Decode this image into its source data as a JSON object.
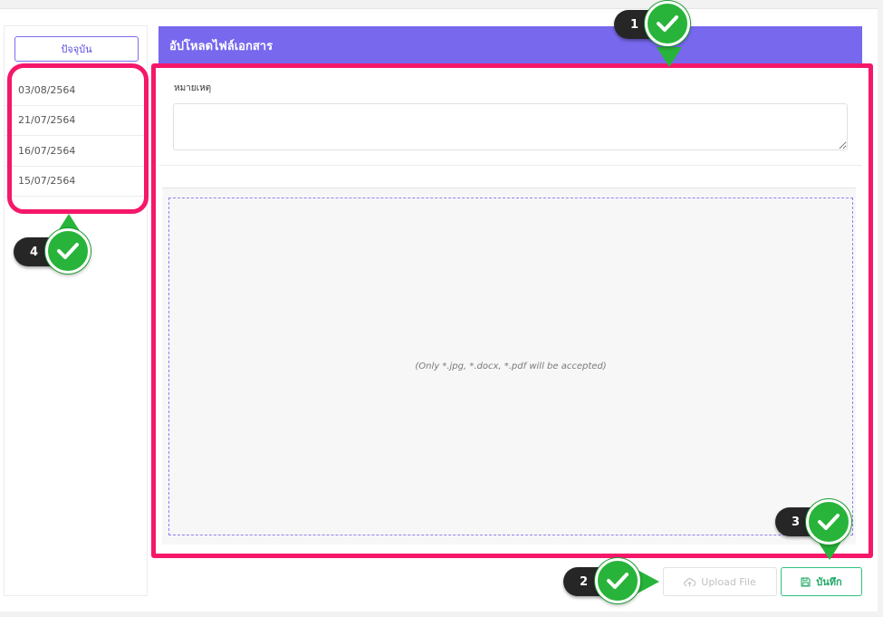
{
  "sidebar": {
    "current_label": "ปัจจุบัน",
    "dates": [
      "03/08/2564",
      "21/07/2564",
      "16/07/2564",
      "15/07/2564"
    ]
  },
  "panel": {
    "title": "อัปโหลดไฟล์เอกสาร",
    "note_label": "หมายเหตุ",
    "note_value": "",
    "dropzone_hint": "(Only *.jpg, *.docx, *.pdf will be accepted)"
  },
  "buttons": {
    "upload_label": "Upload File",
    "upload_icon": "cloud-upload-icon",
    "save_label": "บันทึก",
    "save_icon": "floppy-disk-icon"
  },
  "annotations": {
    "marker_numbers": [
      "1",
      "2",
      "3",
      "4"
    ],
    "highlight_color": "#f5176a",
    "check_color": "#28b43a"
  },
  "colors": {
    "header_bg": "#7768ee",
    "accent_purple": "#7b6cf0",
    "save_green": "#2ec27e"
  }
}
